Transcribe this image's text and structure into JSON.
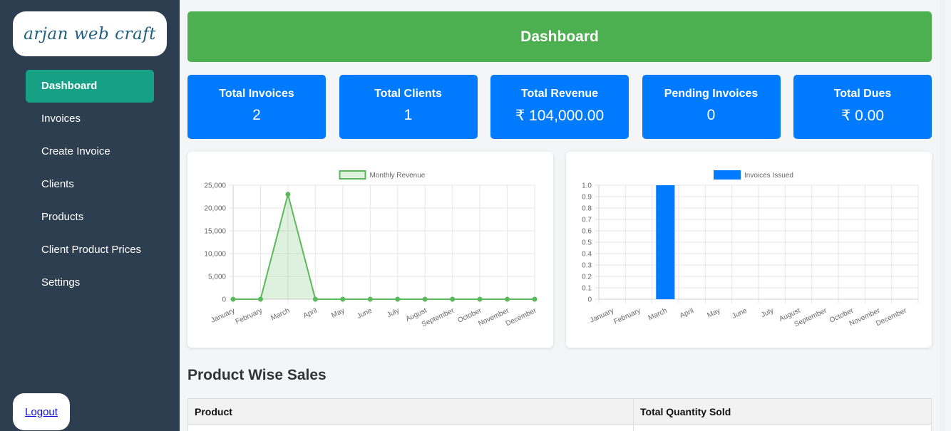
{
  "brand": {
    "logo_text": "arjan web craft"
  },
  "sidebar": {
    "items": [
      {
        "label": "Dashboard",
        "active": true
      },
      {
        "label": "Invoices"
      },
      {
        "label": "Create Invoice"
      },
      {
        "label": "Clients"
      },
      {
        "label": "Products"
      },
      {
        "label": "Client Product Prices"
      },
      {
        "label": "Settings"
      }
    ],
    "logout_label": "Logout"
  },
  "header": {
    "title": "Dashboard"
  },
  "cards": [
    {
      "title": "Total Invoices",
      "value": "2"
    },
    {
      "title": "Total Clients",
      "value": "1"
    },
    {
      "title": "Total Revenue",
      "value": "₹ 104,000.00"
    },
    {
      "title": "Pending Invoices",
      "value": "0"
    },
    {
      "title": "Total Dues",
      "value": "₹ 0.00"
    }
  ],
  "colors": {
    "sidebar_bg": "#2c3e50",
    "active_nav": "#16a085",
    "header_bg": "#4caf50",
    "card_bg": "#007bff",
    "line_series": "#5cb85c",
    "bar_series": "#007bff"
  },
  "chart_data": [
    {
      "type": "line",
      "x": [
        "January",
        "February",
        "March",
        "April",
        "May",
        "June",
        "July",
        "August",
        "September",
        "October",
        "November",
        "December"
      ],
      "series": [
        {
          "name": "Monthly Revenue",
          "values": [
            0,
            0,
            23000,
            0,
            0,
            0,
            0,
            0,
            0,
            0,
            0,
            0
          ]
        }
      ],
      "yticks": [
        "25,000",
        "20,000",
        "15,000",
        "10,000",
        "5,000",
        "0"
      ],
      "ylim": [
        0,
        25000
      ],
      "grid": true,
      "legend": "top-center",
      "fill": true
    },
    {
      "type": "bar",
      "categories": [
        "January",
        "February",
        "March",
        "April",
        "May",
        "June",
        "July",
        "August",
        "September",
        "October",
        "November",
        "December"
      ],
      "series": [
        {
          "name": "Invoices Issued",
          "values": [
            0,
            0,
            1,
            0,
            0,
            0,
            0,
            0,
            0,
            0,
            0,
            0
          ]
        }
      ],
      "yticks": [
        "1.0",
        "0.9",
        "0.8",
        "0.7",
        "0.6",
        "0.5",
        "0.4",
        "0.3",
        "0.2",
        "0.1",
        "0"
      ],
      "ylim": [
        0,
        1
      ],
      "grid": true,
      "legend": "top-center"
    }
  ],
  "product_sales": {
    "title": "Product Wise Sales",
    "columns": [
      "Product",
      "Total Quantity Sold"
    ]
  }
}
